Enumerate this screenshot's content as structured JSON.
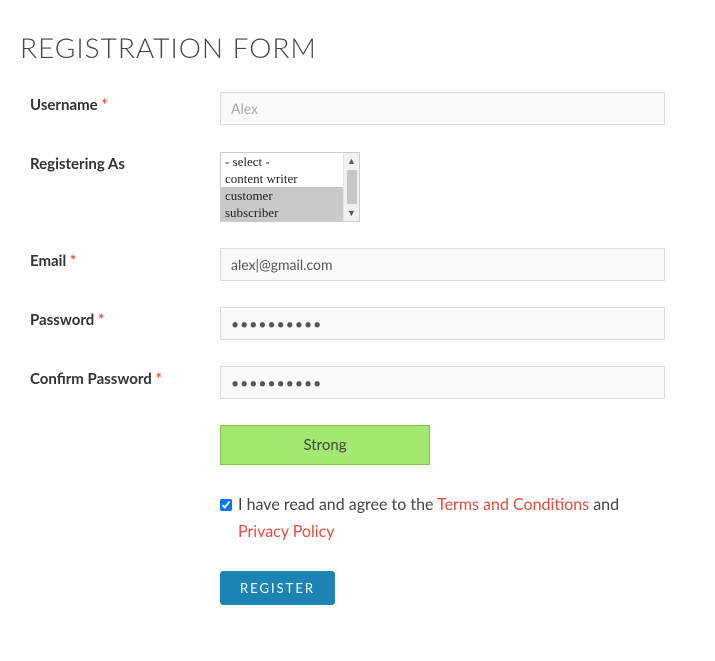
{
  "heading": "REGISTRATION FORM",
  "required_marker": "*",
  "fields": {
    "username": {
      "label": "Username",
      "required": true,
      "placeholder": "Alex",
      "value": ""
    },
    "registering_as": {
      "label": "Registering As",
      "required": false,
      "options": [
        "- select -",
        "content writer",
        "customer",
        "subscriber"
      ],
      "selected": [
        "customer",
        "subscriber"
      ]
    },
    "email": {
      "label": "Email",
      "required": true,
      "value": "alex|@gmail.com"
    },
    "password": {
      "label": "Password",
      "required": true,
      "mask": "••••••••••"
    },
    "confirm_password": {
      "label": "Confirm Password",
      "required": true,
      "mask": "••••••••••"
    }
  },
  "strength": {
    "label": "Strong",
    "bg_color": "#a3e871",
    "border_color": "#7fc24c"
  },
  "terms": {
    "checked": true,
    "prefix": "I have read and agree to the ",
    "link1": "Terms and Conditions",
    "middle": " and ",
    "link2": "Privacy Policy"
  },
  "submit_label": "REGISTER"
}
